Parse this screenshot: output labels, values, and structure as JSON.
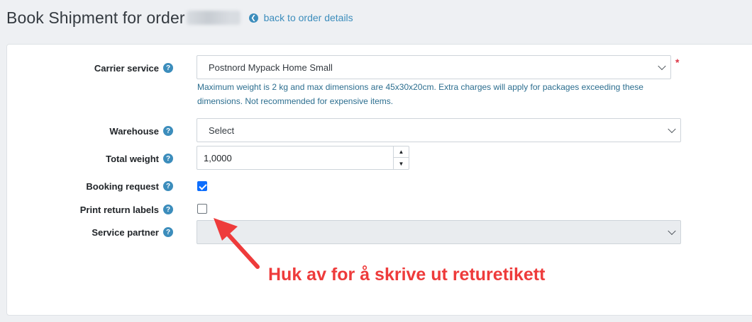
{
  "page": {
    "title": "Book Shipment for order",
    "back_link": "back to order details"
  },
  "form": {
    "carrier_service": {
      "label": "Carrier service",
      "value": "Postnord Mypack Home Small",
      "required_mark": "*",
      "hint": "Maximum weight is 2 kg and max dimensions are 45x30x20cm. Extra charges will apply for packages exceeding these dimensions. Not recommended for expensive items."
    },
    "warehouse": {
      "label": "Warehouse",
      "value": "Select"
    },
    "total_weight": {
      "label": "Total weight",
      "value": "1,0000"
    },
    "booking_request": {
      "label": "Booking request",
      "checked": true
    },
    "print_return_labels": {
      "label": "Print return labels",
      "checked": false
    },
    "service_partner": {
      "label": "Service partner",
      "value": ""
    }
  },
  "annotation": {
    "text": "Huk av for å skrive ut returetikett",
    "color": "#ee3b3b"
  },
  "colors": {
    "accent": "#3c8dbc",
    "checkbox_checked": "#0d6efd",
    "required": "#dc3545"
  },
  "icons": {
    "help": "question-circle-icon",
    "back": "arrow-left-circle-icon",
    "dropdown": "chevron-down-icon"
  }
}
